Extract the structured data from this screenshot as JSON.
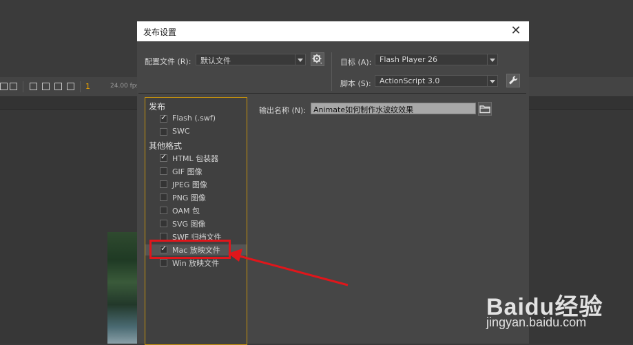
{
  "background": {
    "frame_number": "1",
    "fps_text": "24.00 fps"
  },
  "dialog": {
    "title": "发布设置",
    "close_label": "✕",
    "profile_label": "配置文件 (R):",
    "profile_value": "默认文件",
    "target_label": "目标 (A):",
    "target_value": "Flash Player 26",
    "script_label": "脚本 (S):",
    "script_value": "ActionScript 3.0",
    "output_label": "输出名称 (N):",
    "output_value": "Animate如何制作水波纹效果"
  },
  "publish": {
    "section_title": "发布",
    "items": [
      {
        "label": "Flash (.swf)",
        "checked": true
      },
      {
        "label": "SWC",
        "checked": false
      }
    ]
  },
  "other_formats": {
    "section_title": "其他格式",
    "items": [
      {
        "label": "HTML 包装器",
        "checked": true
      },
      {
        "label": "GIF 图像",
        "checked": false
      },
      {
        "label": "JPEG 图像",
        "checked": false
      },
      {
        "label": "PNG 图像",
        "checked": false
      },
      {
        "label": "OAM 包",
        "checked": false
      },
      {
        "label": "SVG 图像",
        "checked": false
      },
      {
        "label": "SWF 归档文件",
        "checked": false
      },
      {
        "label": "Mac 放映文件",
        "checked": true
      },
      {
        "label": "Win 放映文件",
        "checked": false
      }
    ]
  },
  "annotation_color": "#e0161b",
  "watermark": {
    "logo": "Baidu经验",
    "url": "jingyan.baidu.com"
  },
  "icons": [
    "gear-icon",
    "wrench-icon",
    "folder-icon",
    "close-icon",
    "dropdown-arrow-icon",
    "checkbox-icon"
  ]
}
